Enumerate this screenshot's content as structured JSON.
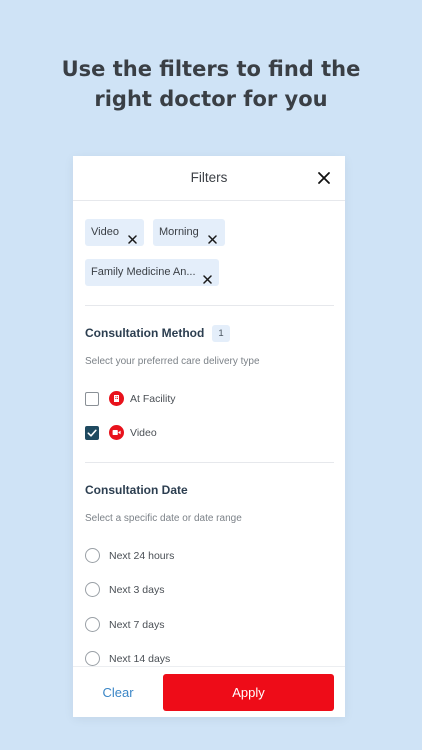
{
  "headline": {
    "line1": "Use the filters to find the",
    "line2": "right doctor for you"
  },
  "panel": {
    "title": "Filters",
    "close_icon": "close-icon"
  },
  "active_chips": [
    {
      "label": "Video"
    },
    {
      "label": "Morning"
    },
    {
      "label": "Family Medicine An..."
    }
  ],
  "consultation_method": {
    "title": "Consultation Method",
    "count": "1",
    "helper": "Select your preferred care delivery type",
    "options": [
      {
        "label": "At Facility",
        "checked": false,
        "icon": "facility-icon"
      },
      {
        "label": "Video",
        "checked": true,
        "icon": "video-icon"
      }
    ]
  },
  "consultation_date": {
    "title": "Consultation Date",
    "helper": "Select a specific date or date range",
    "options": [
      {
        "label": "Next 24 hours",
        "selected": false
      },
      {
        "label": "Next 3 days",
        "selected": false
      },
      {
        "label": "Next 7 days",
        "selected": false
      },
      {
        "label": "Next 14 days",
        "selected": false
      }
    ]
  },
  "footer": {
    "clear_label": "Clear",
    "apply_label": "Apply"
  },
  "colors": {
    "background": "#cfe3f6",
    "accent_red": "#ee0c18",
    "checkbox_checked": "#1f4a60",
    "link_blue": "#3b86c6",
    "chip_bg": "#e4eefa"
  }
}
